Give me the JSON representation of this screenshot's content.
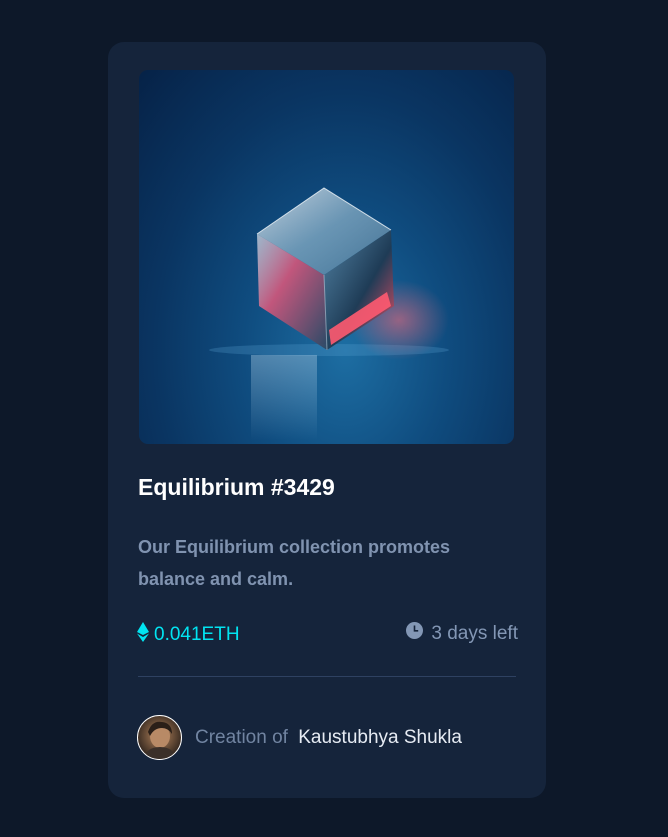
{
  "card": {
    "title": "Equilibrium #3429",
    "description": "Our Equilibrium collection promotes balance and calm.",
    "price": "0.041ETH",
    "time_left": "3 days left",
    "creator_label": "Creation of",
    "creator_name": "Kaustubhya Shukla"
  },
  "icons": {
    "price": "ethereum-icon",
    "time": "clock-icon"
  },
  "colors": {
    "page_background": "#0d1829",
    "card_background": "#15243b",
    "accent_cyan": "#01e4f1",
    "muted_text": "#8093b0",
    "divider": "#2e4161"
  }
}
